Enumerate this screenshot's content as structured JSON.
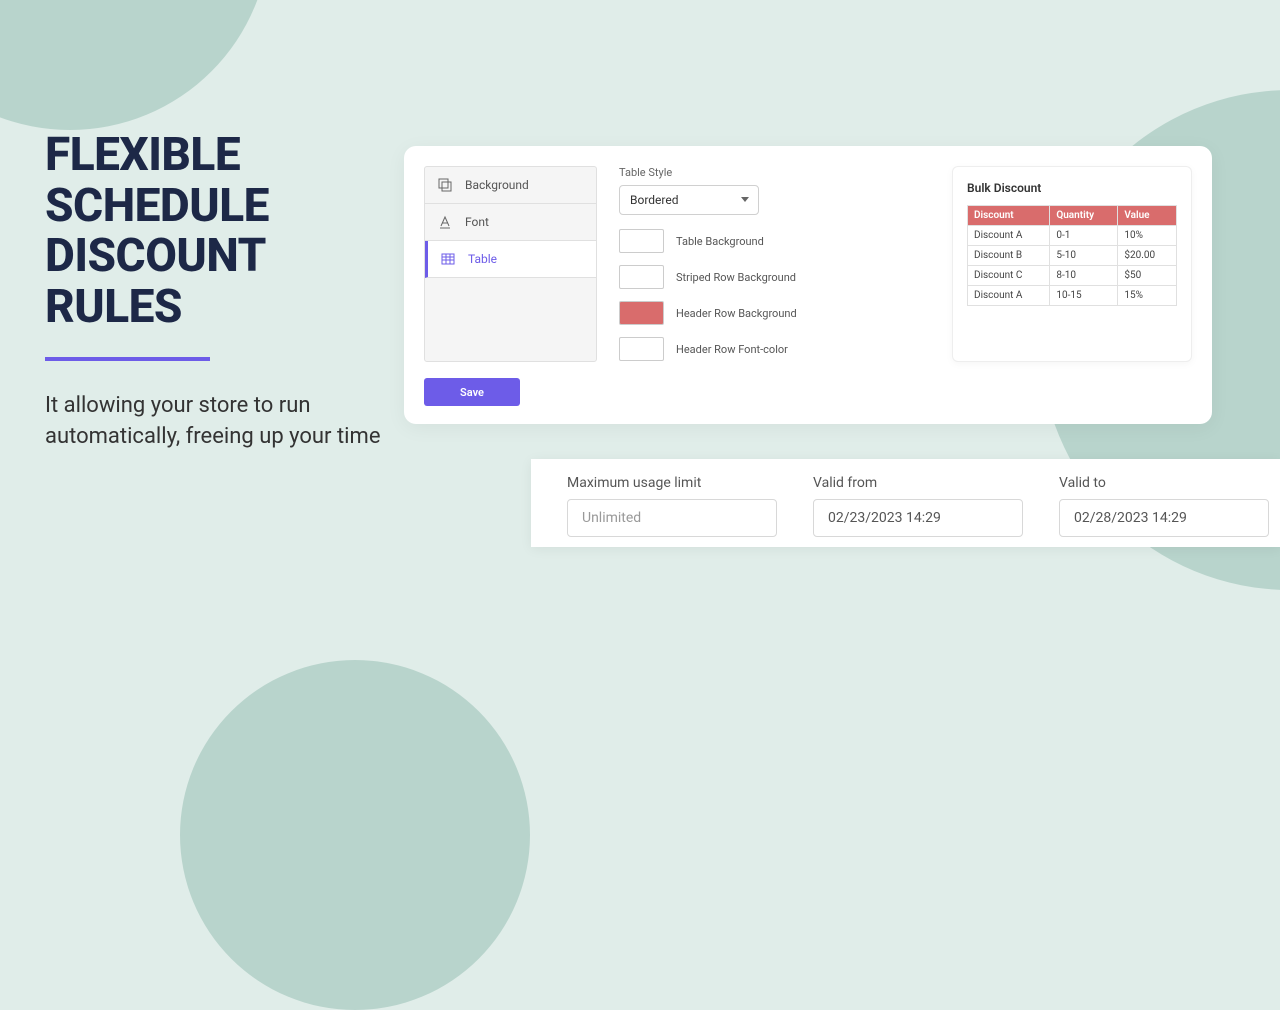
{
  "hero": {
    "title": "FLEXIBLE SCHEDULE DISCOUNT RULES",
    "subtitle": "It allowing your store to run automatically, freeing up your time"
  },
  "sidebar": {
    "items": [
      {
        "label": "Background",
        "icon": "background"
      },
      {
        "label": "Font",
        "icon": "font"
      },
      {
        "label": "Table",
        "icon": "table"
      }
    ]
  },
  "controls": {
    "table_style_label": "Table Style",
    "table_style_value": "Bordered",
    "rows": [
      {
        "label": "Table Background",
        "color": "#ffffff"
      },
      {
        "label": "Striped Row Background",
        "color": "#ffffff"
      },
      {
        "label": "Header Row Background",
        "color": "#d96c6c"
      },
      {
        "label": "Header Row Font-color",
        "color": "#ffffff"
      }
    ]
  },
  "preview": {
    "title": "Bulk Discount",
    "headers": [
      "Discount",
      "Quantity",
      "Value"
    ],
    "rows": [
      [
        "Discount A",
        "0-1",
        "10%"
      ],
      [
        "Discount B",
        "5-10",
        "$20.00"
      ],
      [
        "Discount C",
        "8-10",
        "$50"
      ],
      [
        "Discount A",
        "10-15",
        "15%"
      ]
    ]
  },
  "save_label": "Save",
  "bottom": {
    "max_usage_label": "Maximum usage limit",
    "max_usage_placeholder": "Unlimited",
    "valid_from_label": "Valid from",
    "valid_from_value": "02/23/2023 14:29",
    "valid_to_label": "Valid to",
    "valid_to_value": "02/28/2023 14:29"
  }
}
